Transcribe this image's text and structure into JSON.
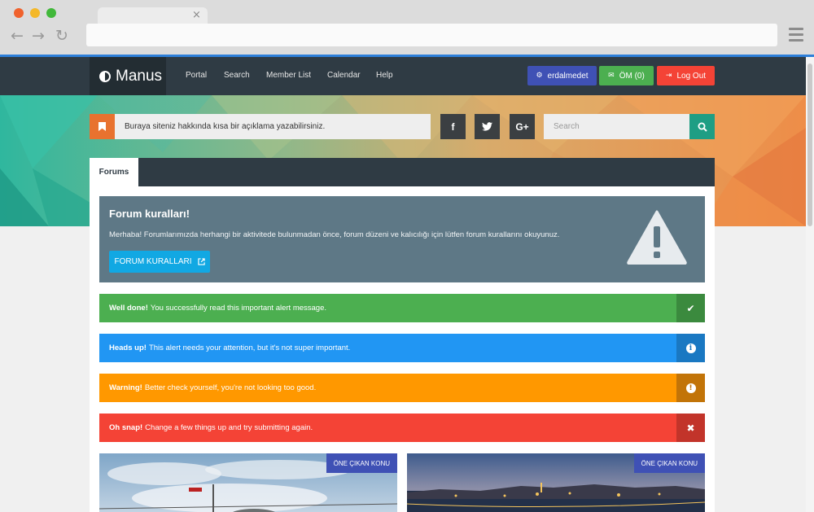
{
  "brand": {
    "name": "Manus"
  },
  "nav": {
    "links": [
      "Portal",
      "Search",
      "Member List",
      "Calendar",
      "Help"
    ],
    "user_label": "erdalmedet",
    "pm_label": "ÖM (0)",
    "logout_label": "Log Out"
  },
  "header": {
    "description": "Buraya siteniz hakkında kısa bir açıklama yazabilirsiniz.",
    "social": [
      "f",
      "t",
      "G+"
    ],
    "search_placeholder": "Search"
  },
  "tabs": {
    "active": "Forums"
  },
  "rules": {
    "title": "Forum kuralları!",
    "text": "Merhaba! Forumlarımızda herhangi bir aktivitede bulunmadan önce, forum düzeni ve kalıcılığı için lütfen forum kurallarını okuyunuz.",
    "button": "FORUM KURALLARI"
  },
  "alerts": [
    {
      "strong": "Well done!",
      "text": "You successfully read this important alert message.",
      "color": "#4caf50",
      "icon_bg": "#3b8a3e",
      "icon": "✔"
    },
    {
      "strong": "Heads up!",
      "text": "This alert needs your attention, but it's not super important.",
      "color": "#2196f3",
      "icon_bg": "#1a78c2",
      "icon": "i"
    },
    {
      "strong": "Warning!",
      "text": "Better check yourself, you're not looking too good.",
      "color": "#ff9800",
      "icon_bg": "#c27408",
      "icon": "!"
    },
    {
      "strong": "Oh snap!",
      "text": "Change a few things up and try submitting again.",
      "color": "#f44336",
      "icon_bg": "#c2342a",
      "icon": "✖"
    }
  ],
  "featured": {
    "badge": "ÖNE ÇIKAN KONU"
  },
  "colors": {
    "navbar": "#2f3b44",
    "user_button": "#3f51b5",
    "pm_button": "#4caf50",
    "logout_button": "#f44336",
    "rules_bg": "#5e7886",
    "rules_button": "#11a8e3",
    "search_button": "#1e9e84",
    "bookmark": "#e8722f"
  }
}
